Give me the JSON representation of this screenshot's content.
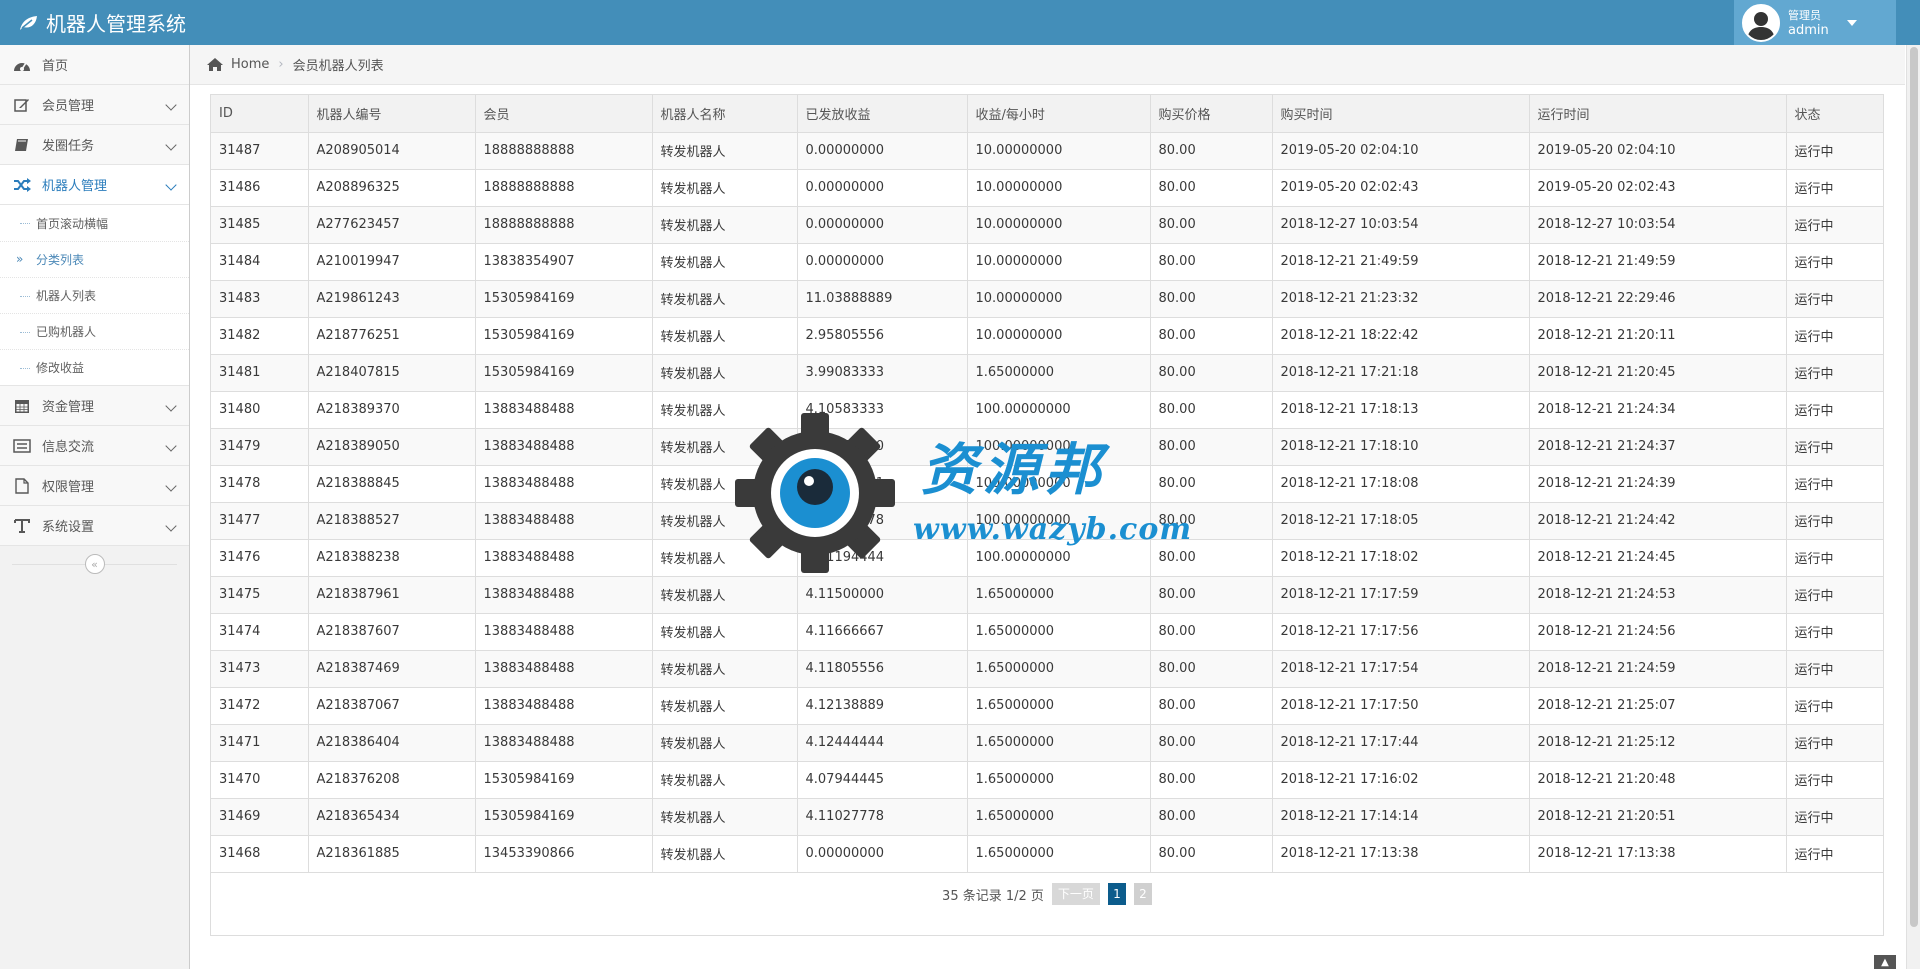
{
  "app": {
    "title": "机器人管理系统"
  },
  "user": {
    "role": "管理员",
    "name": "admin"
  },
  "sidebar": {
    "items": [
      {
        "label": "首页",
        "icon": "dashboard-icon"
      },
      {
        "label": "会员管理",
        "icon": "edit-icon"
      },
      {
        "label": "发圈任务",
        "icon": "book-icon"
      },
      {
        "label": "机器人管理",
        "icon": "shuffle-icon"
      },
      {
        "label": "资金管理",
        "icon": "calendar-icon"
      },
      {
        "label": "信息交流",
        "icon": "list-icon"
      },
      {
        "label": "权限管理",
        "icon": "file-icon"
      },
      {
        "label": "系统设置",
        "icon": "text-icon"
      }
    ],
    "submenu": [
      {
        "label": "首页滚动横幅"
      },
      {
        "label": "分类列表"
      },
      {
        "label": "机器人列表"
      },
      {
        "label": "已购机器人"
      },
      {
        "label": "修改收益"
      }
    ]
  },
  "breadcrumb": {
    "home": "Home",
    "current": "会员机器人列表"
  },
  "table": {
    "columns": [
      "ID",
      "机器人编号",
      "会员",
      "机器人名称",
      "已发放收益",
      "收益/每小时",
      "购买价格",
      "购买时间",
      "运行时间",
      "状态"
    ],
    "rows": [
      [
        "31487",
        "A208905014",
        "18888888888",
        "转发机器人",
        "0.00000000",
        "10.00000000",
        "80.00",
        "2019-05-20 02:04:10",
        "2019-05-20 02:04:10",
        "运行中"
      ],
      [
        "31486",
        "A208896325",
        "18888888888",
        "转发机器人",
        "0.00000000",
        "10.00000000",
        "80.00",
        "2019-05-20 02:02:43",
        "2019-05-20 02:02:43",
        "运行中"
      ],
      [
        "31485",
        "A277623457",
        "18888888888",
        "转发机器人",
        "0.00000000",
        "10.00000000",
        "80.00",
        "2018-12-27 10:03:54",
        "2018-12-27 10:03:54",
        "运行中"
      ],
      [
        "31484",
        "A210019947",
        "13838354907",
        "转发机器人",
        "0.00000000",
        "10.00000000",
        "80.00",
        "2018-12-21 21:49:59",
        "2018-12-21 21:49:59",
        "运行中"
      ],
      [
        "31483",
        "A219861243",
        "15305984169",
        "转发机器人",
        "11.03888889",
        "10.00000000",
        "80.00",
        "2018-12-21 21:23:32",
        "2018-12-21 22:29:46",
        "运行中"
      ],
      [
        "31482",
        "A218776251",
        "15305984169",
        "转发机器人",
        "2.95805556",
        "10.00000000",
        "80.00",
        "2018-12-21 18:22:42",
        "2018-12-21 21:20:11",
        "运行中"
      ],
      [
        "31481",
        "A218407815",
        "15305984169",
        "转发机器人",
        "3.99083333",
        "1.65000000",
        "80.00",
        "2018-12-21 17:21:18",
        "2018-12-21 21:20:45",
        "运行中"
      ],
      [
        "31480",
        "A218389370",
        "13883488488",
        "转发机器人",
        "4.10583333",
        "100.00000000",
        "80.00",
        "2018-12-21 17:18:13",
        "2018-12-21 21:24:34",
        "运行中"
      ],
      [
        "31479",
        "A218389050",
        "13883488488",
        "转发机器人",
        "4.10750000",
        "100.00000000",
        "80.00",
        "2018-12-21 17:18:10",
        "2018-12-21 21:24:37",
        "运行中"
      ],
      [
        "31478",
        "A218388845",
        "13883488488",
        "转发机器人",
        "4.10861111",
        "100.00000000",
        "80.00",
        "2018-12-21 17:18:08",
        "2018-12-21 21:24:39",
        "运行中"
      ],
      [
        "31477",
        "A218388527",
        "13883488488",
        "转发机器人",
        "4.11027778",
        "100.00000000",
        "80.00",
        "2018-12-21 17:18:05",
        "2018-12-21 21:24:42",
        "运行中"
      ],
      [
        "31476",
        "A218388238",
        "13883488488",
        "转发机器人",
        "4.11194444",
        "100.00000000",
        "80.00",
        "2018-12-21 17:18:02",
        "2018-12-21 21:24:45",
        "运行中"
      ],
      [
        "31475",
        "A218387961",
        "13883488488",
        "转发机器人",
        "4.11500000",
        "1.65000000",
        "80.00",
        "2018-12-21 17:17:59",
        "2018-12-21 21:24:53",
        "运行中"
      ],
      [
        "31474",
        "A218387607",
        "13883488488",
        "转发机器人",
        "4.11666667",
        "1.65000000",
        "80.00",
        "2018-12-21 17:17:56",
        "2018-12-21 21:24:56",
        "运行中"
      ],
      [
        "31473",
        "A218387469",
        "13883488488",
        "转发机器人",
        "4.11805556",
        "1.65000000",
        "80.00",
        "2018-12-21 17:17:54",
        "2018-12-21 21:24:59",
        "运行中"
      ],
      [
        "31472",
        "A218387067",
        "13883488488",
        "转发机器人",
        "4.12138889",
        "1.65000000",
        "80.00",
        "2018-12-21 17:17:50",
        "2018-12-21 21:25:07",
        "运行中"
      ],
      [
        "31471",
        "A218386404",
        "13883488488",
        "转发机器人",
        "4.12444444",
        "1.65000000",
        "80.00",
        "2018-12-21 17:17:44",
        "2018-12-21 21:25:12",
        "运行中"
      ],
      [
        "31470",
        "A218376208",
        "15305984169",
        "转发机器人",
        "4.07944445",
        "1.65000000",
        "80.00",
        "2018-12-21 17:16:02",
        "2018-12-21 21:20:48",
        "运行中"
      ],
      [
        "31469",
        "A218365434",
        "15305984169",
        "转发机器人",
        "4.11027778",
        "1.65000000",
        "80.00",
        "2018-12-21 17:14:14",
        "2018-12-21 21:20:51",
        "运行中"
      ],
      [
        "31468",
        "A218361885",
        "13453390866",
        "转发机器人",
        "0.00000000",
        "1.65000000",
        "80.00",
        "2018-12-21 17:13:38",
        "2018-12-21 17:13:38",
        "运行中"
      ]
    ]
  },
  "pagination": {
    "summary": "35 条记录 1/2 页",
    "next_label": "下一页",
    "pages": [
      "1",
      "2"
    ],
    "current": "1"
  },
  "watermark": {
    "title": "资源邦",
    "url": "www.wazyb.com"
  },
  "colors": {
    "navbar": "#438eb9",
    "accent": "#2b7dbc",
    "watermark": "#1b8fd1"
  }
}
